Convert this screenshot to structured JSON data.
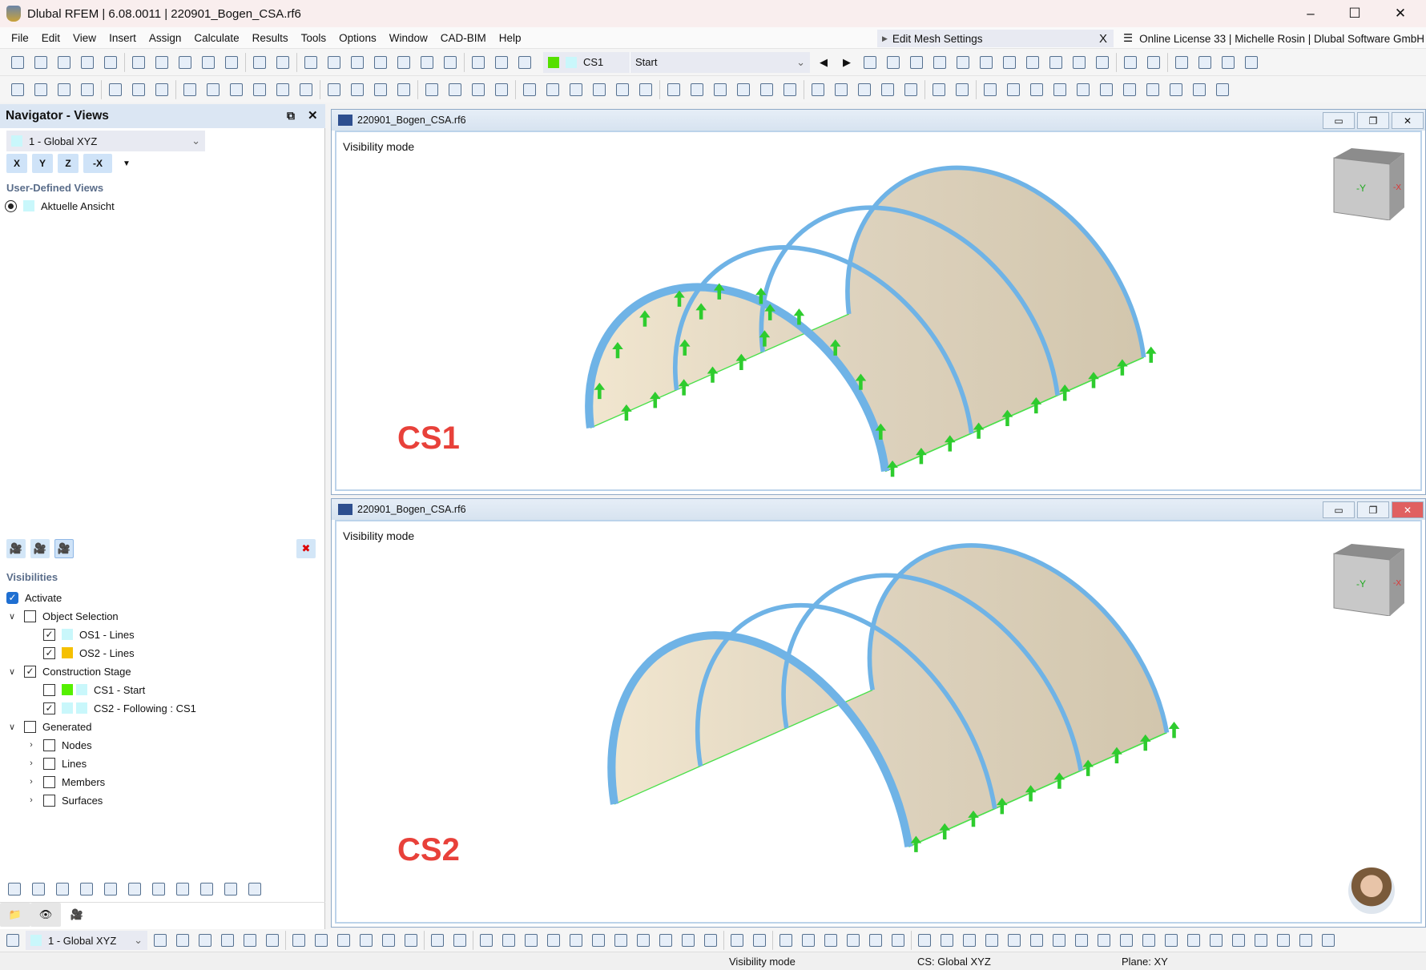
{
  "title_bar": {
    "title": "Dlubal RFEM | 6.08.0011 | 220901_Bogen_CSA.rf6",
    "minimize": "–",
    "maximize": "☐",
    "close": "✕"
  },
  "menu": [
    "File",
    "Edit",
    "View",
    "Insert",
    "Assign",
    "Calculate",
    "Results",
    "Tools",
    "Options",
    "Window",
    "CAD-BIM",
    "Help"
  ],
  "mesh_box": {
    "label": "Edit Mesh Settings",
    "close": "X"
  },
  "license": "Online License 33 | Michelle Rosin | Dlubal Software GmbH",
  "toolbar": {
    "cs_combo": "CS1",
    "stage_combo": "Start",
    "cs_color": "#55e000"
  },
  "navigator": {
    "title": "Navigator - Views",
    "view_select": "1 - Global XYZ",
    "axis_buttons": [
      "X",
      "Y",
      "Z",
      "-X"
    ],
    "user_views_title": "User-Defined Views",
    "user_views": [
      {
        "label": "Aktuelle Ansicht",
        "selected": true
      }
    ],
    "visibilities_title": "Visibilities",
    "activate": {
      "label": "Activate",
      "checked": true
    },
    "tree": [
      {
        "label": "Object Selection",
        "level": 0,
        "checked": false,
        "expander": "open"
      },
      {
        "label": "OS1 - Lines",
        "level": 1,
        "checked": true,
        "colors": [
          "#c9f7fb"
        ]
      },
      {
        "label": "OS2 - Lines",
        "level": 1,
        "checked": true,
        "colors": [
          "#f5c000"
        ]
      },
      {
        "label": "Construction Stage",
        "level": 0,
        "checked": true,
        "expander": "open"
      },
      {
        "label": "CS1 - Start",
        "level": 1,
        "checked": false,
        "colors": [
          "#55f000",
          "#c9f7fb"
        ]
      },
      {
        "label": "CS2 - Following : CS1",
        "level": 1,
        "checked": true,
        "colors": [
          "#c9f7fb",
          "#c9f7fb"
        ]
      },
      {
        "label": "Generated",
        "level": 0,
        "checked": false,
        "expander": "open"
      },
      {
        "label": "Nodes",
        "level": 1,
        "checked": false,
        "expander": "closed"
      },
      {
        "label": "Lines",
        "level": 1,
        "checked": false,
        "expander": "closed"
      },
      {
        "label": "Members",
        "level": 1,
        "checked": false,
        "expander": "closed"
      },
      {
        "label": "Surfaces",
        "level": 1,
        "checked": false,
        "expander": "closed"
      }
    ]
  },
  "views": [
    {
      "file": "220901_Bogen_CSA.rf6",
      "mode": "Visibility mode",
      "stage": "CS1",
      "cube_labels": [
        "-Y",
        "-X"
      ]
    },
    {
      "file": "220901_Bogen_CSA.rf6",
      "mode": "Visibility mode",
      "stage": "CS2",
      "cube_labels": [
        "-Y",
        "-X"
      ]
    }
  ],
  "bottom_toolbar": {
    "view_select": "1 - Global XYZ"
  },
  "status": {
    "mode": "Visibility mode",
    "cs": "CS: Global XYZ",
    "plane": "Plane: XY"
  },
  "colors": {
    "stage_label": "#e8413a",
    "member": "#6fb3e6",
    "surface": "#ddd2bd",
    "support": "#2ecc2e"
  }
}
